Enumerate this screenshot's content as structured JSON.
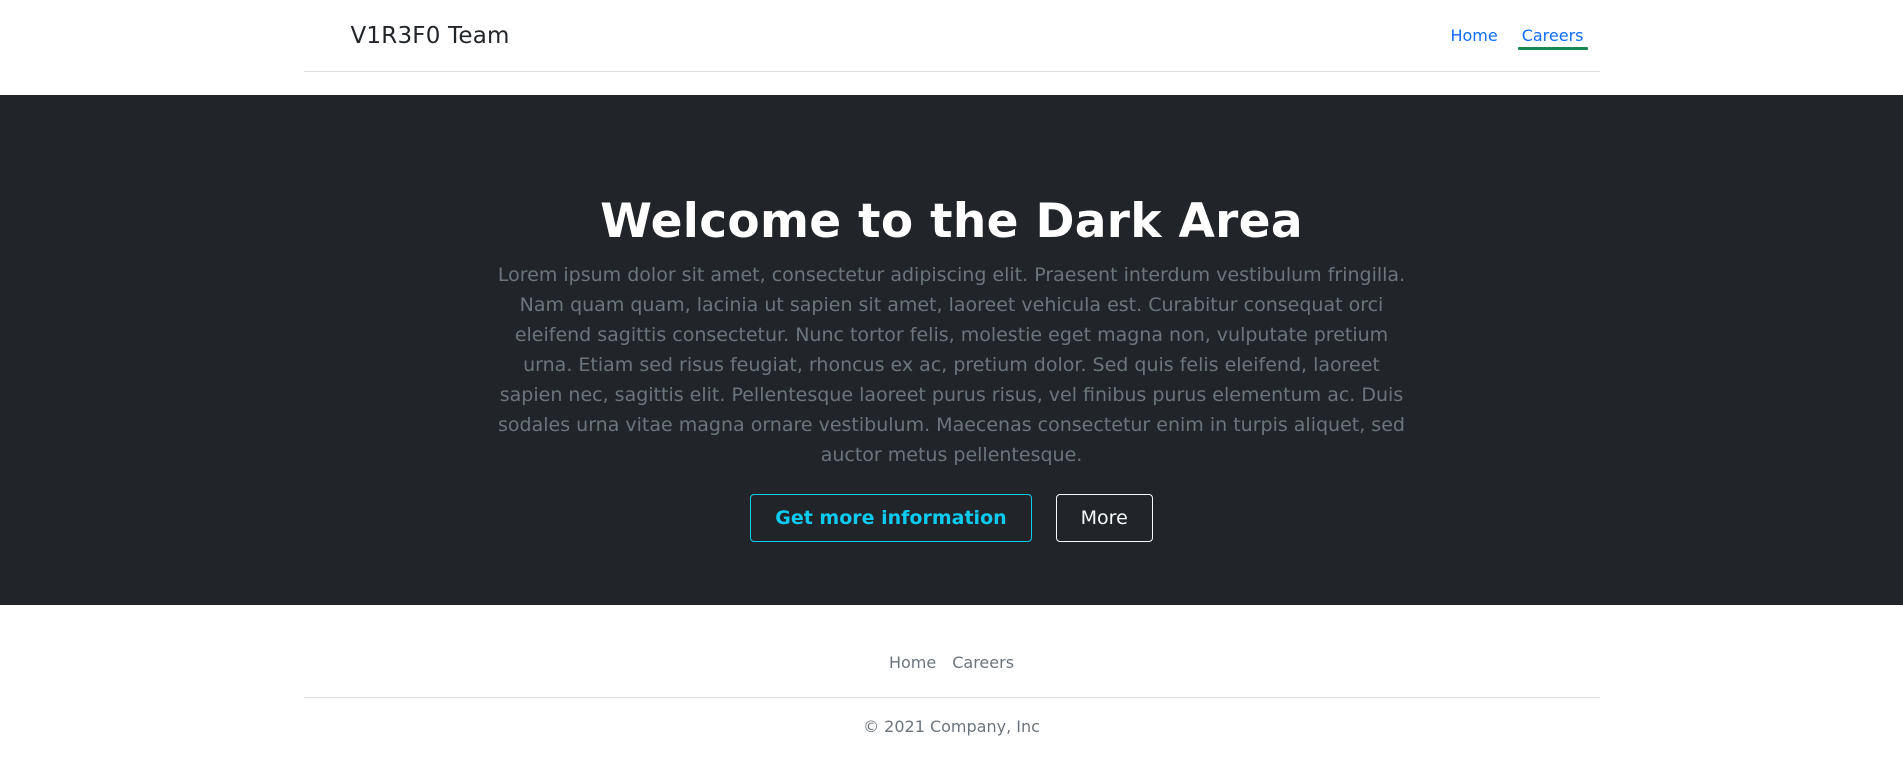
{
  "header": {
    "brand": "V1R3F0 Team",
    "nav": [
      {
        "label": "Home",
        "active": false
      },
      {
        "label": "Careers",
        "active": true
      }
    ]
  },
  "hero": {
    "title": "Welcome to the Dark Area",
    "text": "Lorem ipsum dolor sit amet, consectetur adipiscing elit. Praesent interdum vestibulum fringilla. Nam quam quam, lacinia ut sapien sit amet, laoreet vehicula est. Curabitur consequat orci eleifend sagittis consectetur. Nunc tortor felis, molestie eget magna non, vulputate pretium urna. Etiam sed risus feugiat, rhoncus ex ac, pretium dolor. Sed quis felis eleifend, laoreet sapien nec, sagittis elit. Pellentesque laoreet purus risus, vel finibus purus elementum ac. Duis sodales urna vitae magna ornare vestibulum. Maecenas consectetur enim in turpis aliquet, sed auctor metus pellentesque.",
    "primary_button": "Get more information",
    "secondary_button": "More"
  },
  "footer": {
    "nav": [
      {
        "label": "Home"
      },
      {
        "label": "Careers"
      }
    ],
    "copyright": "© 2021 Company, Inc"
  },
  "colors": {
    "hero_bg": "#212529",
    "link": "#0d6efd",
    "active_underline": "#198754",
    "info": "#0dcaf0",
    "muted": "#6c757d"
  }
}
